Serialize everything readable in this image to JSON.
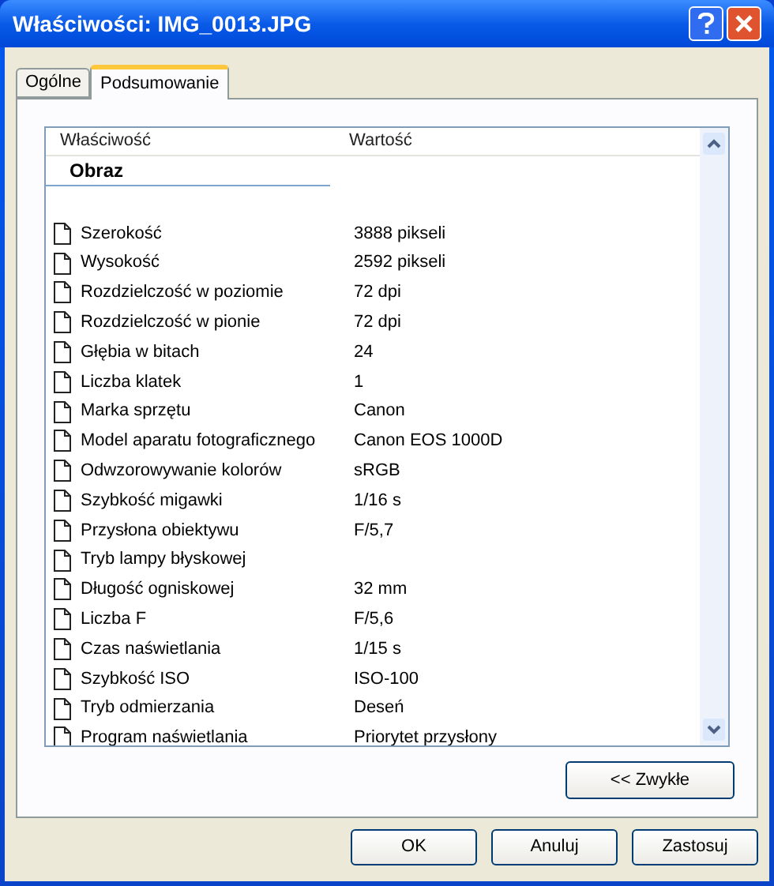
{
  "window": {
    "title": "Właściwości: IMG_0013.JPG"
  },
  "tabs": [
    {
      "label": "Ogólne",
      "selected": false
    },
    {
      "label": "Podsumowanie",
      "selected": true
    }
  ],
  "list": {
    "columns": [
      "Właściwość",
      "Wartość"
    ],
    "group": "Obraz",
    "rows": [
      {
        "property": "Szerokość",
        "value": "3888 pikseli"
      },
      {
        "property": "Wysokość",
        "value": "2592 pikseli"
      },
      {
        "property": "Rozdzielczość w poziomie",
        "value": "72 dpi"
      },
      {
        "property": "Rozdzielczość w pionie",
        "value": "72 dpi"
      },
      {
        "property": "Głębia w bitach",
        "value": "24"
      },
      {
        "property": "Liczba klatek",
        "value": "1"
      },
      {
        "property": "Marka sprzętu",
        "value": "Canon"
      },
      {
        "property": "Model aparatu fotograficznego",
        "value": "Canon EOS 1000D"
      },
      {
        "property": "Odwzorowywanie kolorów",
        "value": "sRGB"
      },
      {
        "property": "Szybkość migawki",
        "value": "1/16 s"
      },
      {
        "property": "Przysłona obiektywu",
        "value": "F/5,7"
      },
      {
        "property": "Tryb lampy błyskowej"
      },
      {
        "property": "Długość ogniskowej",
        "value": "32 mm"
      },
      {
        "property": "Liczba F",
        "value": "F/5,6"
      },
      {
        "property": "Czas naświetlania",
        "value": "1/15 s"
      },
      {
        "property": "Szybkość ISO",
        "value": "ISO-100"
      },
      {
        "property": "Tryb odmierzania",
        "value": "Deseń"
      },
      {
        "property": "Program naświetlania",
        "value": "Priorytet przysłony"
      }
    ]
  },
  "toggle_button": "<< Zwykłe",
  "buttons": [
    "OK",
    "Anuluj",
    "Zastosuj"
  ]
}
